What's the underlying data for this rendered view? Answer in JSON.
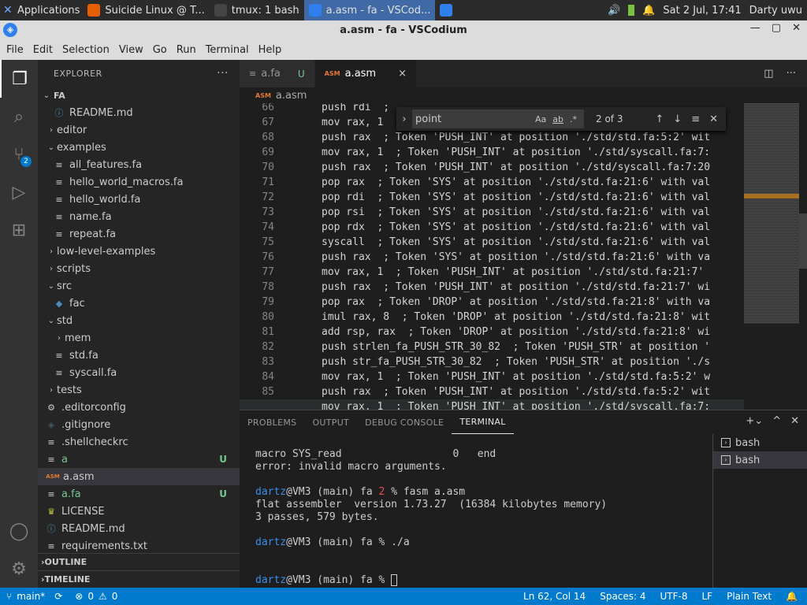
{
  "os_panel": {
    "apps_label": "Applications",
    "tasks": [
      {
        "label": "Suicide Linux @ T...",
        "color": "#e66000"
      },
      {
        "label": "tmux: 1 bash",
        "color": "#444444"
      },
      {
        "label": "a.asm - fa - VSCod...",
        "color": "#2f80ed"
      },
      {
        "label": "",
        "color": "#2f80ed"
      }
    ],
    "clock": "Sat  2 Jul, 17:41",
    "user": "Darty uwu"
  },
  "window": {
    "title": "a.asm - fa - VSCodium"
  },
  "menu": [
    "File",
    "Edit",
    "Selection",
    "View",
    "Go",
    "Run",
    "Terminal",
    "Help"
  ],
  "activity": {
    "scm_badge": "2"
  },
  "explorer": {
    "header": "EXPLORER",
    "more": "···",
    "root": "FA",
    "tree": [
      {
        "label": "README.md",
        "icon": "info-icon",
        "glyph": "ⓘ",
        "color": "#519aba",
        "indent": 2,
        "chev": ""
      },
      {
        "label": "editor",
        "icon": "chevron-right-icon",
        "glyph": "",
        "color": "",
        "indent": 1,
        "chev": "›"
      },
      {
        "label": "examples",
        "icon": "chevron-down-icon",
        "glyph": "",
        "color": "",
        "indent": 1,
        "chev": "⌄"
      },
      {
        "label": "all_features.fa",
        "icon": "file-icon",
        "glyph": "≡",
        "color": "#cccccc",
        "indent": 2,
        "chev": ""
      },
      {
        "label": "hello_world_macros.fa",
        "icon": "file-icon",
        "glyph": "≡",
        "color": "#cccccc",
        "indent": 2,
        "chev": ""
      },
      {
        "label": "hello_world.fa",
        "icon": "file-icon",
        "glyph": "≡",
        "color": "#cccccc",
        "indent": 2,
        "chev": ""
      },
      {
        "label": "name.fa",
        "icon": "file-icon",
        "glyph": "≡",
        "color": "#cccccc",
        "indent": 2,
        "chev": ""
      },
      {
        "label": "repeat.fa",
        "icon": "file-icon",
        "glyph": "≡",
        "color": "#cccccc",
        "indent": 2,
        "chev": ""
      },
      {
        "label": "low-level-examples",
        "icon": "chevron-right-icon",
        "glyph": "",
        "color": "",
        "indent": 1,
        "chev": "›"
      },
      {
        "label": "scripts",
        "icon": "chevron-right-icon",
        "glyph": "",
        "color": "",
        "indent": 1,
        "chev": "›"
      },
      {
        "label": "src",
        "icon": "chevron-down-icon",
        "glyph": "",
        "color": "",
        "indent": 1,
        "chev": "⌄"
      },
      {
        "label": "fac",
        "icon": "python-icon",
        "glyph": "◆",
        "color": "#4b8bbe",
        "indent": 2,
        "chev": ""
      },
      {
        "label": "std",
        "icon": "chevron-down-icon",
        "glyph": "",
        "color": "",
        "indent": 1,
        "chev": "⌄"
      },
      {
        "label": "mem",
        "icon": "chevron-right-icon",
        "glyph": "",
        "color": "",
        "indent": 2,
        "chev": "›"
      },
      {
        "label": "std.fa",
        "icon": "file-icon",
        "glyph": "≡",
        "color": "#cccccc",
        "indent": 2,
        "chev": ""
      },
      {
        "label": "syscall.fa",
        "icon": "file-icon",
        "glyph": "≡",
        "color": "#cccccc",
        "indent": 2,
        "chev": ""
      },
      {
        "label": "tests",
        "icon": "chevron-right-icon",
        "glyph": "",
        "color": "",
        "indent": 1,
        "chev": "›"
      },
      {
        "label": ".editorconfig",
        "icon": "gear-icon",
        "glyph": "⚙",
        "color": "#cccccc",
        "indent": 1,
        "chev": ""
      },
      {
        "label": ".gitignore",
        "icon": "git-icon",
        "glyph": "◈",
        "color": "#41535b",
        "indent": 1,
        "chev": ""
      },
      {
        "label": ".shellcheckrc",
        "icon": "file-icon",
        "glyph": "≡",
        "color": "#cccccc",
        "indent": 1,
        "chev": ""
      },
      {
        "label": "a",
        "icon": "file-icon",
        "glyph": "≡",
        "color": "#cccccc",
        "indent": 1,
        "chev": "",
        "status": "U"
      },
      {
        "label": "a.asm",
        "icon": "asm-icon",
        "glyph": "ASM",
        "color": "#e37933",
        "indent": 1,
        "chev": "",
        "selected": true
      },
      {
        "label": "a.fa",
        "icon": "file-icon",
        "glyph": "≡",
        "color": "#cccccc",
        "indent": 1,
        "chev": "",
        "status": "U"
      },
      {
        "label": "LICENSE",
        "icon": "license-icon",
        "glyph": "♛",
        "color": "#cbcb41",
        "indent": 1,
        "chev": ""
      },
      {
        "label": "README.md",
        "icon": "info-icon",
        "glyph": "ⓘ",
        "color": "#519aba",
        "indent": 1,
        "chev": ""
      },
      {
        "label": "requirements.txt",
        "icon": "file-icon",
        "glyph": "≡",
        "color": "#cccccc",
        "indent": 1,
        "chev": ""
      }
    ],
    "outline": "OUTLINE",
    "timeline": "TIMELINE"
  },
  "tabs": [
    {
      "label": "a.fa",
      "status": "U",
      "active": false
    },
    {
      "label": "a.asm",
      "close": "×",
      "active": true
    }
  ],
  "breadcrumb": "a.asm",
  "find": {
    "value": "point",
    "count": "2 of 3"
  },
  "code": [
    {
      "n": "66",
      "t": "push rdi  ;"
    },
    {
      "n": "67",
      "t": "mov rax, 1"
    },
    {
      "n": "68",
      "t": "push rax  ; Token 'PUSH_INT' at position './std/std.fa:5:2' wit"
    },
    {
      "n": "69",
      "t": "mov rax, 1  ; Token 'PUSH_INT' at position './std/syscall.fa:7:"
    },
    {
      "n": "70",
      "t": "push rax  ; Token 'PUSH_INT' at position './std/syscall.fa:7:20"
    },
    {
      "n": "71",
      "t": "pop rax  ; Token 'SYS' at position './std/std.fa:21:6' with val"
    },
    {
      "n": "72",
      "t": "pop rdi  ; Token 'SYS' at position './std/std.fa:21:6' with val"
    },
    {
      "n": "73",
      "t": "pop rsi  ; Token 'SYS' at position './std/std.fa:21:6' with val"
    },
    {
      "n": "74",
      "t": "pop rdx  ; Token 'SYS' at position './std/std.fa:21:6' with val"
    },
    {
      "n": "75",
      "t": "syscall  ; Token 'SYS' at position './std/std.fa:21:6' with val"
    },
    {
      "n": "76",
      "t": "push rax  ; Token 'SYS' at position './std/std.fa:21:6' with va"
    },
    {
      "n": "77",
      "t": "mov rax, 1  ; Token 'PUSH_INT' at position './std/std.fa:21:7' "
    },
    {
      "n": "78",
      "t": "push rax  ; Token 'PUSH_INT' at position './std/std.fa:21:7' wi"
    },
    {
      "n": "79",
      "t": "pop rax  ; Token 'DROP' at position './std/std.fa:21:8' with va"
    },
    {
      "n": "80",
      "t": "imul rax, 8  ; Token 'DROP' at position './std/std.fa:21:8' wit"
    },
    {
      "n": "81",
      "t": "add rsp, rax  ; Token 'DROP' at position './std/std.fa:21:8' wi"
    },
    {
      "n": "82",
      "t": "push strlen_fa_PUSH_STR_30_82  ; Token 'PUSH_STR' at position '"
    },
    {
      "n": "83",
      "t": "push str_fa_PUSH_STR_30_82  ; Token 'PUSH_STR' at position './s"
    },
    {
      "n": "84",
      "t": "mov rax, 1  ; Token 'PUSH_INT' at position './std/std.fa:5:2' w"
    },
    {
      "n": "85",
      "t": "push rax  ; Token 'PUSH_INT' at position './std/std.fa:5:2' wit"
    },
    {
      "n": "",
      "t": "mov rax, 1  ; Token 'PUSH_INT' at position './std/syscall.fa:7:"
    }
  ],
  "panel": {
    "tabs": [
      "PROBLEMS",
      "OUTPUT",
      "DEBUG CONSOLE",
      "TERMINAL"
    ],
    "terminal_lines": [
      {
        "plain": "macro SYS_read                  0   end"
      },
      {
        "plain": "error: invalid macro arguments."
      },
      {
        "plain": ""
      },
      {
        "user": "dartz",
        "rest": "@VM3 (main) fa ",
        "err": "2",
        "after": " % fasm a.asm"
      },
      {
        "plain": "flat assembler  version 1.73.27  (16384 kilobytes memory)"
      },
      {
        "plain": "3 passes, 579 bytes."
      },
      {
        "plain": ""
      },
      {
        "user": "dartz",
        "rest": "@VM3 (main) fa % ./a"
      },
      {
        "plain": ""
      },
      {
        "plain": ""
      },
      {
        "user": "dartz",
        "rest": "@VM3 (main) fa % ",
        "cursor": true
      }
    ],
    "terminals": [
      "bash",
      "bash"
    ]
  },
  "statusbar": {
    "branch": "main*",
    "errors": "0",
    "warnings": "0",
    "position": "Ln 62, Col 14",
    "spaces": "Spaces: 4",
    "encoding": "UTF-8",
    "eol": "LF",
    "language": "Plain Text"
  }
}
